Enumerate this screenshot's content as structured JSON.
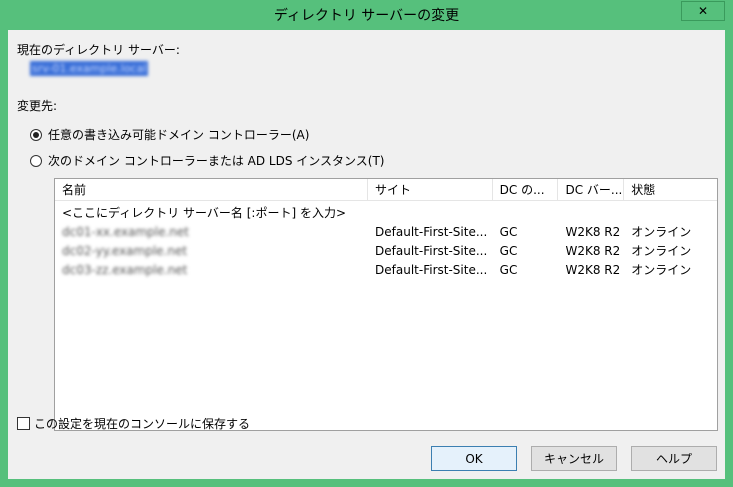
{
  "window": {
    "title": "ディレクトリ サーバーの変更",
    "close_label": "✕"
  },
  "current": {
    "label": "現在のディレクトリ サーバー:",
    "value": "srv-01.example.local"
  },
  "change_to": {
    "label": "変更先:",
    "options": [
      {
        "label": "任意の書き込み可能ドメイン コントローラー(A)",
        "checked": true
      },
      {
        "label": "次のドメイン コントローラーまたは AD LDS インスタンス(T)",
        "checked": false
      }
    ]
  },
  "list": {
    "headers": [
      "名前",
      "サイト",
      "DC の...",
      "DC バー...",
      "状態"
    ],
    "placeholder_row": "<ここにディレクトリ サーバー名 [:ポート] を入力>",
    "rows": [
      {
        "name": "dc01-xx.example.net",
        "site": "Default-First-Site...",
        "dc_type": "GC",
        "dc_version": "W2K8 R2",
        "status": "オンライン"
      },
      {
        "name": "dc02-yy.example.net",
        "site": "Default-First-Site...",
        "dc_type": "GC",
        "dc_version": "W2K8 R2",
        "status": "オンライン"
      },
      {
        "name": "dc03-zz.example.net",
        "site": "Default-First-Site...",
        "dc_type": "GC",
        "dc_version": "W2K8 R2",
        "status": "オンライン"
      }
    ]
  },
  "save_setting": {
    "label": "この設定を現在のコンソールに保存する",
    "checked": false
  },
  "buttons": {
    "ok": "OK",
    "cancel": "キャンセル",
    "help": "ヘルプ"
  }
}
